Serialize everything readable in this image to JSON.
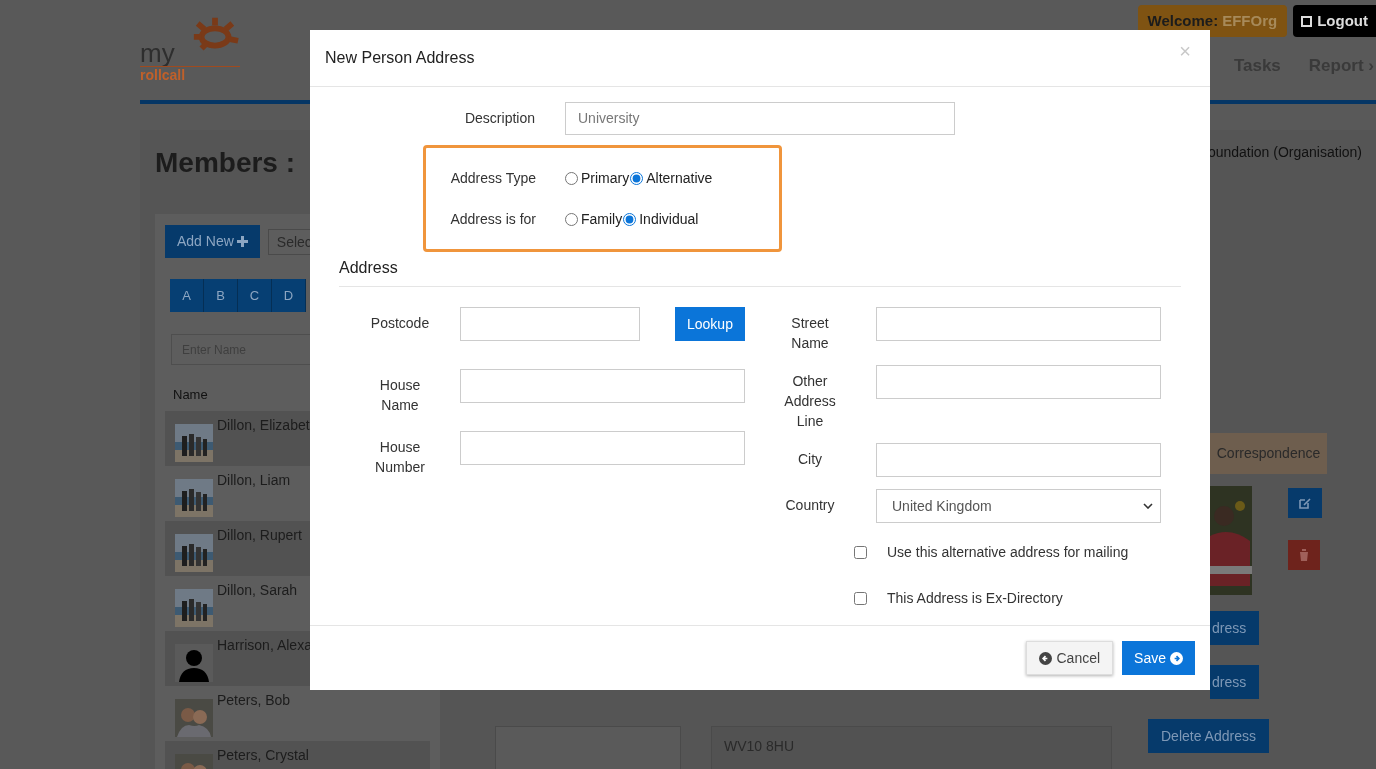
{
  "header": {
    "logo": {
      "top": "my",
      "bottom": "rollcall"
    },
    "welcome": {
      "label": "Welcome:",
      "user": "EFFOrg"
    },
    "logout": "Logout",
    "nav": [
      "Tasks",
      "Report ›"
    ]
  },
  "page": {
    "title": "Members :",
    "org": {
      "name": "oundation",
      "kind": "(Organisation)"
    }
  },
  "members_panel": {
    "add_new": "Add New",
    "select": "Selec",
    "letters": [
      "A",
      "B",
      "C",
      "D"
    ],
    "search_placeholder": "Enter Name",
    "column": "Name",
    "rows": [
      {
        "name": "Dillon, Elizabet",
        "kind": "family"
      },
      {
        "name": "Dillon, Liam",
        "kind": "family"
      },
      {
        "name": "Dillon, Rupert",
        "kind": "family"
      },
      {
        "name": "Dillon, Sarah",
        "kind": "family"
      },
      {
        "name": "Harrison, Alexa",
        "kind": "silhouette"
      },
      {
        "name": "Peters, Bob",
        "kind": "couple"
      },
      {
        "name": "Peters, Crystal",
        "kind": "couple"
      }
    ]
  },
  "address_preview": {
    "text": "WV10 8HU"
  },
  "right_panel": {
    "tab": "Correspondence",
    "buttons": [
      "dress",
      "dress",
      "Delete Address"
    ]
  },
  "modal": {
    "title": "New Person Address",
    "close": "×",
    "description": {
      "label": "Description",
      "value": "University"
    },
    "radio_groups": [
      {
        "label": "Address Type",
        "options": [
          {
            "label": "Primary",
            "selected": false
          },
          {
            "label": "Alternative",
            "selected": true
          }
        ]
      },
      {
        "label": "Address is for",
        "options": [
          {
            "label": "Family",
            "selected": false
          },
          {
            "label": "Individual",
            "selected": true
          }
        ]
      }
    ],
    "section": "Address",
    "left_fields": [
      {
        "label": "Postcode",
        "kind": "short"
      },
      {
        "label": "House Name",
        "kind": "text"
      },
      {
        "label": "House Number",
        "kind": "text"
      }
    ],
    "lookup": "Lookup",
    "right_fields": [
      {
        "label": "Street Name",
        "kind": "text"
      },
      {
        "label": "Other Address Line",
        "kind": "text"
      },
      {
        "label": "City",
        "kind": "text"
      },
      {
        "label": "Country",
        "kind": "select",
        "value": "United Kingdom"
      }
    ],
    "checkboxes": [
      {
        "label": "Use this alternative address for mailing",
        "checked": false
      },
      {
        "label": "This Address is Ex-Directory",
        "checked": false
      }
    ],
    "cancel": "Cancel",
    "save": "Save"
  }
}
